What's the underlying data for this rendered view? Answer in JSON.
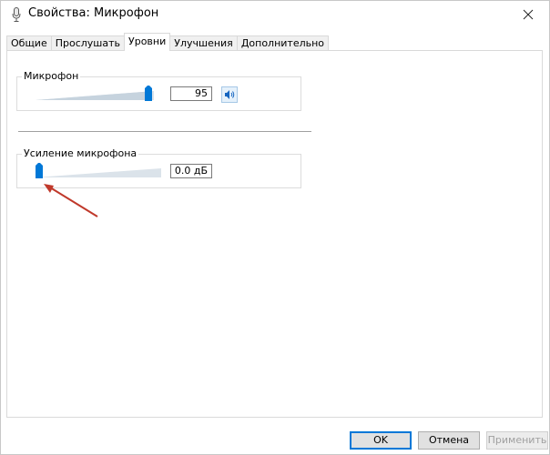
{
  "window": {
    "title": "Свойства: Микрофон"
  },
  "tabs": [
    {
      "label": "Общие",
      "active": false
    },
    {
      "label": "Прослушать",
      "active": false
    },
    {
      "label": "Уровни",
      "active": true
    },
    {
      "label": "Улучшения",
      "active": false
    },
    {
      "label": "Дополнительно",
      "active": false
    }
  ],
  "microphone": {
    "label": "Микрофон",
    "value": "95",
    "level_percent": 95
  },
  "boost": {
    "label": "Усиление микрофона",
    "value": "0.0 дБ",
    "level_percent": 0
  },
  "buttons": {
    "ok": "OK",
    "cancel": "Отмена",
    "apply": "Применить"
  },
  "colors": {
    "accent": "#0078d7",
    "annotation_arrow": "#c0392b"
  },
  "icons": {
    "title": "microphone-icon",
    "close": "close-icon",
    "speaker": "speaker-icon"
  }
}
